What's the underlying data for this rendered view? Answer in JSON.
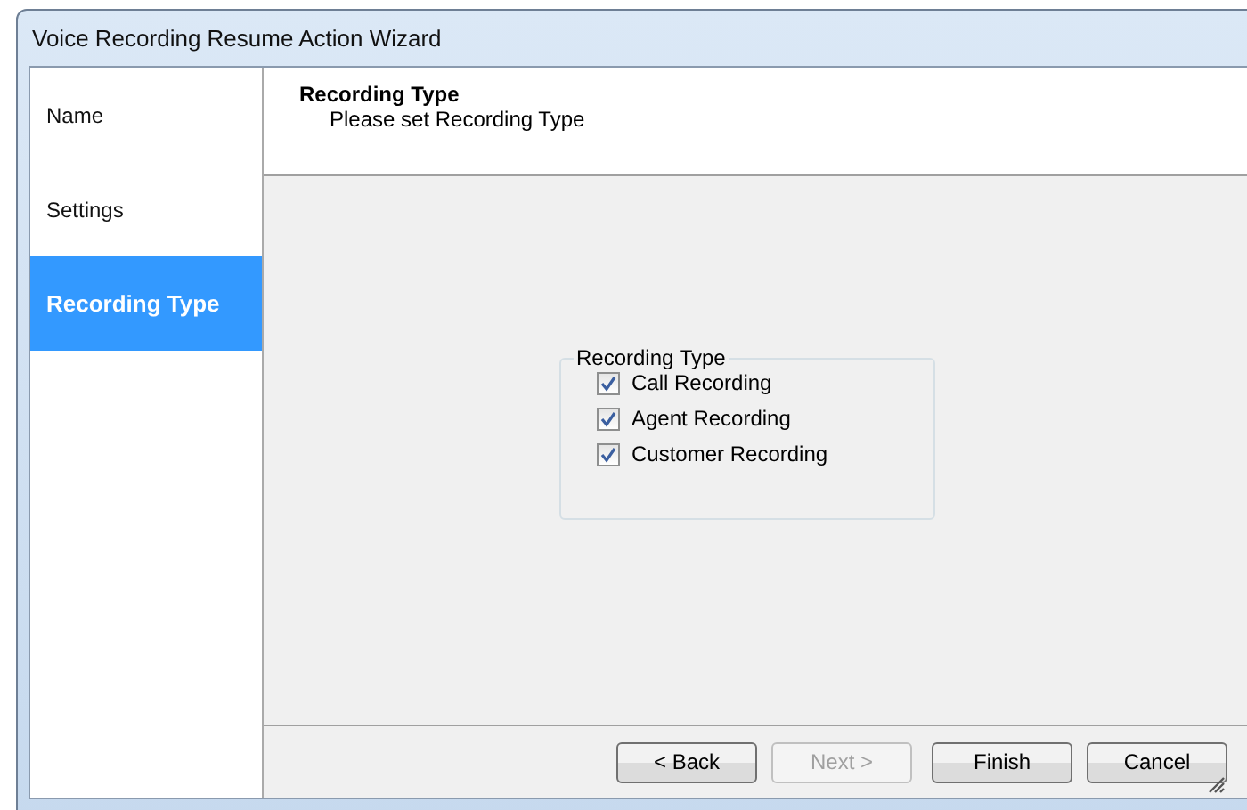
{
  "window": {
    "title": "Voice Recording Resume Action Wizard"
  },
  "sidebar": {
    "items": [
      {
        "label": "Name",
        "selected": false
      },
      {
        "label": "Settings",
        "selected": false
      },
      {
        "label": "Recording Type",
        "selected": true
      }
    ]
  },
  "header": {
    "title": "Recording Type",
    "subtitle": "Please set Recording Type"
  },
  "group": {
    "title": "Recording Type",
    "options": [
      {
        "label": "Call Recording",
        "checked": true
      },
      {
        "label": "Agent Recording",
        "checked": true
      },
      {
        "label": "Customer Recording",
        "checked": true
      }
    ]
  },
  "buttons": [
    {
      "label": "< Back",
      "disabled": false
    },
    {
      "label": "Next >",
      "disabled": true
    },
    {
      "label": "Finish",
      "disabled": false
    },
    {
      "label": "Cancel",
      "disabled": false
    }
  ]
}
